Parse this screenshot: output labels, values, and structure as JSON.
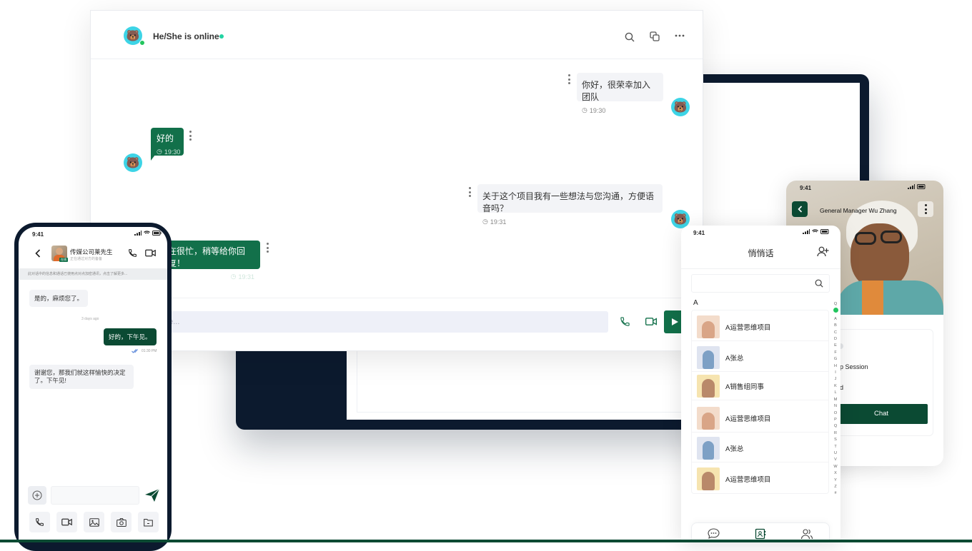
{
  "desktop": {
    "header": {
      "status": "He/She is online"
    },
    "messages": [
      {
        "text": "你好，很荣幸加入团队",
        "time": "19:30"
      },
      {
        "text": "好的",
        "time": "19:30"
      },
      {
        "text": "关于这个项目我有一些想法与您沟通，方便语音吗？",
        "time": "19:31"
      },
      {
        "text": "在很忙，稍等给你回复！",
        "time": "19:31"
      }
    ],
    "input_placeholder": "ge..."
  },
  "phone": {
    "status_time": "9:41",
    "contact_name": "传媒公司莱先生",
    "contact_sub": "正在通过对方的备备",
    "contact_badge": "在线",
    "notice": "此对话中的信息和通话已使用点对点加密通讯，点击了解更多...",
    "messages": [
      {
        "text": "是的，麻烦您了。"
      },
      {
        "divider": "3 days ago"
      },
      {
        "text": "好的，下午见。",
        "time": "01:30 PM"
      },
      {
        "text": "谢谢您，那我们就这样愉快的决定了。下午见!"
      }
    ]
  },
  "contacts": {
    "status_time": "9:41",
    "title": "悄悄话",
    "section": "A",
    "items": [
      "A运营思维项目",
      "A张总",
      "A销售组同事",
      "A运营思维项目",
      "A张总",
      "A运营思维项目"
    ],
    "alphabet": [
      "Q",
      "●",
      "A",
      "B",
      "C",
      "D",
      "E",
      "F",
      "G",
      "H",
      "I",
      "J",
      "K",
      "L",
      "M",
      "N",
      "O",
      "P",
      "Q",
      "R",
      "S",
      "T",
      "U",
      "V",
      "W",
      "X",
      "Y",
      "Z",
      "#"
    ]
  },
  "profile": {
    "status_time": "9:41",
    "title": "General Manager Wu Zhang",
    "row1": "up Session",
    "row2": "nd",
    "chat_button": "Chat"
  },
  "colors": {
    "brand_green": "#12704a",
    "dark_green": "#0b4a33",
    "navy": "#0c1a2e",
    "avatar_cyan": "#3dd4e6",
    "online": "#22c55e"
  }
}
